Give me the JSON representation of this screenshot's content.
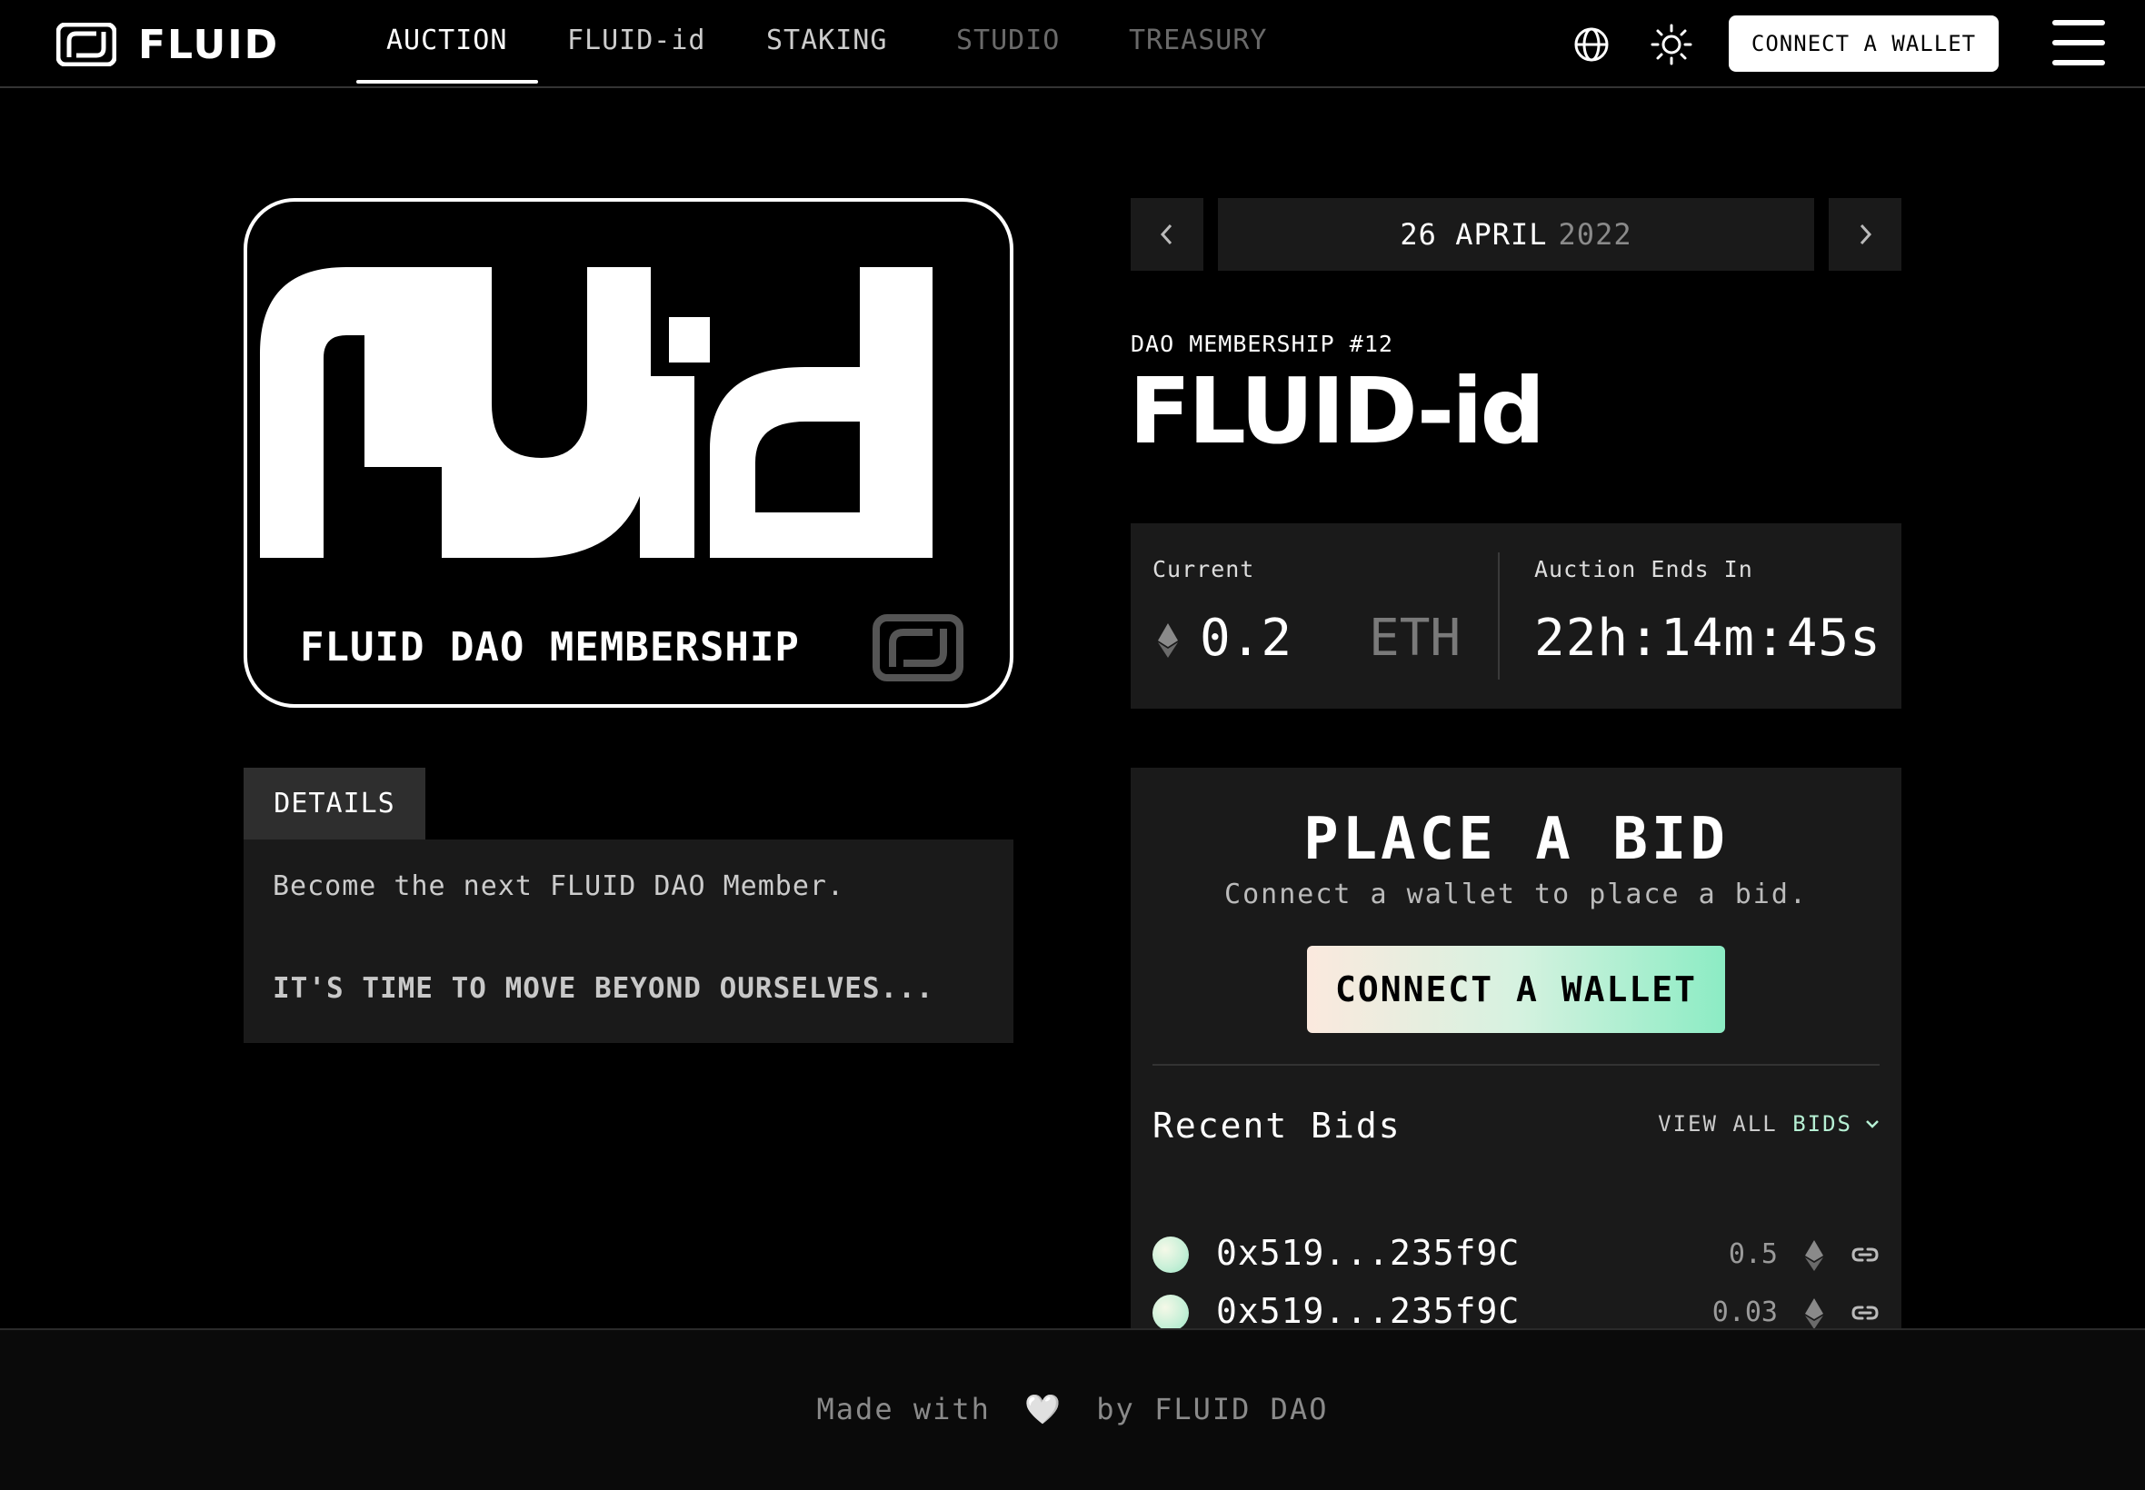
{
  "brand": {
    "name": "FLUID"
  },
  "nav": {
    "links": [
      {
        "label": "AUCTION",
        "state": "active"
      },
      {
        "label": "FLUID-id",
        "state": "normal"
      },
      {
        "label": "STAKING",
        "state": "normal"
      },
      {
        "label": "STUDIO",
        "state": "disabled"
      },
      {
        "label": "TREASURY",
        "state": "disabled"
      }
    ],
    "icons": [
      "globe-icon",
      "sun-icon",
      "hamburger-menu-icon"
    ],
    "connect_label": "CONNECT A WALLET"
  },
  "nft": {
    "art_text": "FLUid",
    "caption": "FLUID DAO MEMBERSHIP"
  },
  "details": {
    "tab_label": "DETAILS",
    "text": "Become the next FLUID DAO Member.",
    "tagline": "IT'S TIME TO MOVE BEYOND OURSELVES..."
  },
  "auction": {
    "date_day_month": "26 APRIL",
    "date_year": "2022",
    "kicker": "DAO MEMBERSHIP #12",
    "title": "FLUID-id",
    "current_label": "Current",
    "current_value": "0.2",
    "current_unit": "ETH",
    "ends_label": "Auction Ends In",
    "ends_value": "22h:14m:45s"
  },
  "bid_panel": {
    "heading": "PLACE A BID",
    "subheading": "Connect a wallet to place a bid.",
    "connect_label": "CONNECT A WALLET",
    "recent_title": "Recent Bids",
    "view_all_prefix": "VIEW ALL",
    "view_all_accent": "BIDS",
    "bids": [
      {
        "address": "0x519...235f9C",
        "amount": "0.5"
      },
      {
        "address": "0x519...235f9C",
        "amount": "0.03"
      }
    ]
  },
  "footer": {
    "prefix": "Made with",
    "heart": "🤍",
    "suffix": "by FLUID DAO"
  },
  "colors": {
    "background": "#000000",
    "panel": "#1a1a1a",
    "accent_mint": "#8cecc4",
    "accent_peach": "#fbe9de"
  }
}
